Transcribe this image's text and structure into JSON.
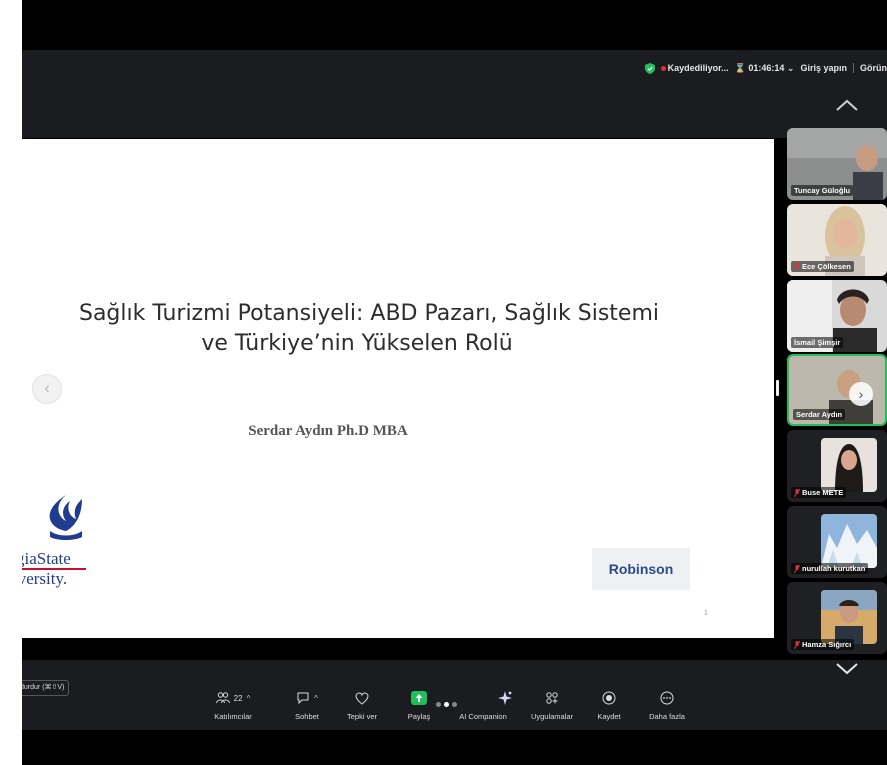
{
  "topbar": {
    "recording_label": "Kaydediliyor...",
    "timer": "01:46:14",
    "sign_in": "Giriş yapın",
    "view": "Görün"
  },
  "slide": {
    "title_line1": "Sağlık Turizmi Potansiyeli: ABD Pazarı, Sağlık Sistemi",
    "title_line2": "ve Türkiye’nin Yükselen Rolü",
    "author": "Serdar Aydın Ph.D MBA",
    "logo_line1": "giaState",
    "logo_line2": "iversity.",
    "badge": "Robinson",
    "page_number": "1"
  },
  "participants": [
    {
      "name": "Tuncay Güloğlu",
      "muted": false
    },
    {
      "name": "Ece Çölkesen",
      "muted": true
    },
    {
      "name": "İsmail Şimşir",
      "muted": false
    },
    {
      "name": "Serdar Aydın",
      "muted": false,
      "speaking": true
    },
    {
      "name": "Buse METE",
      "muted": true
    },
    {
      "name": "nurullah kurutkan",
      "muted": true
    },
    {
      "name": "Hamza Sığırcı",
      "muted": true
    }
  ],
  "toolbar": {
    "stop_video": "deoyu durdur (⌘⇧V)",
    "participants_count": "22",
    "participants": "Katılımcılar",
    "chat": "Sohbet",
    "react": "Tepki ver",
    "share": "Paylaş",
    "ai_companion": "AI Companion",
    "apps": "Uygulamalar",
    "record": "Kaydet",
    "more": "Daha fazla"
  },
  "colors": {
    "share_green": "#1fbf5a",
    "recording_red": "#e0313a",
    "active_speaker_border": "#1fbf5a"
  }
}
